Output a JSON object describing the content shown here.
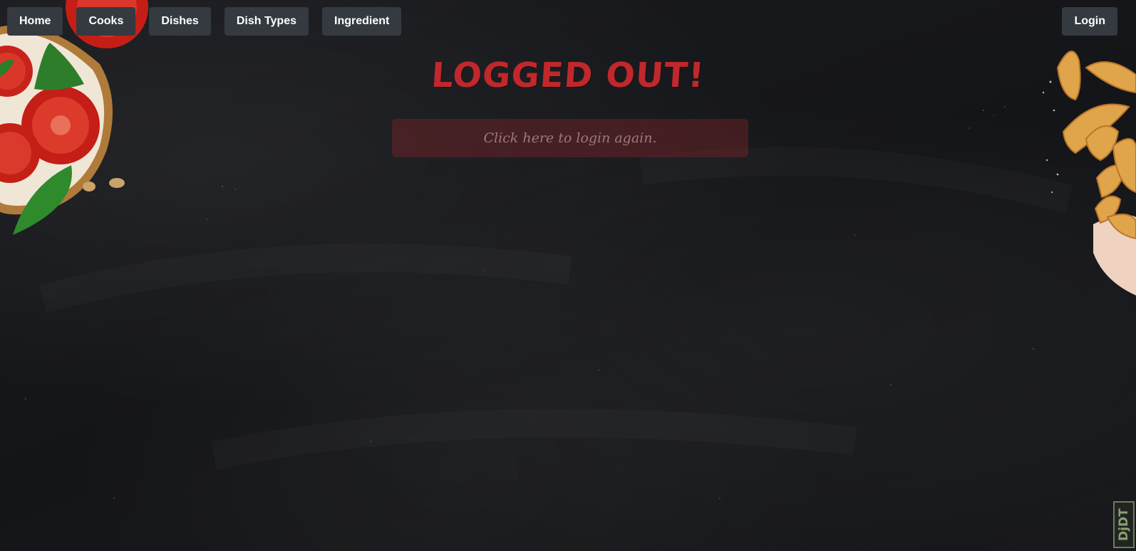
{
  "nav": {
    "items": [
      {
        "label": "Home"
      },
      {
        "label": "Cooks"
      },
      {
        "label": "Dishes"
      },
      {
        "label": "Dish Types"
      },
      {
        "label": "Ingredient"
      }
    ],
    "login_label": "Login"
  },
  "main": {
    "title": "LOGGED OUT!",
    "relogin_label": "Click here to login again."
  },
  "badge": {
    "text": "DjDT"
  },
  "colors": {
    "background": "#16171a",
    "nav_button": "#343a40",
    "nav_text": "#ffffff",
    "title": "#c0282b",
    "relogin_bg": "#782428"
  },
  "decorations": {
    "left": "bruschetta-image",
    "right": "potato-wedges-image"
  }
}
